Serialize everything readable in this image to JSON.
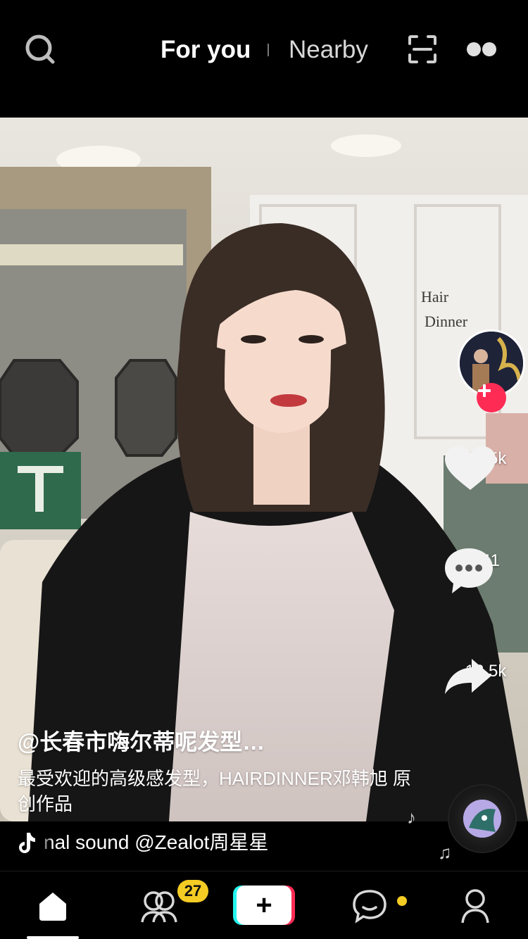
{
  "top_bar": {
    "tabs": [
      {
        "label": "For you",
        "active": true
      },
      {
        "label": "Nearby",
        "active": false
      }
    ],
    "left_icon": "search-icon",
    "right_icons": [
      "scan-icon",
      "live-dots-icon"
    ]
  },
  "video": {
    "scene_sign_line1": "Hair",
    "scene_sign_line2": "Dinner"
  },
  "right_rail": {
    "avatar_icon": "creator-avatar",
    "follow_icon": "plus-icon",
    "likes": "48.5k",
    "comments": "741",
    "shares": "12.5k"
  },
  "caption": {
    "username": "@长春市嗨尔蒂呢发型…",
    "description": "最受欢迎的高级感发型，HAIRDINNER邓韩旭 原创作品"
  },
  "music": {
    "note_icon": "tiktok-note-icon",
    "text": "nal sound     @Zealot周星星"
  },
  "bottom_nav": {
    "items": [
      "home-icon",
      "friends-icon",
      "create-icon",
      "inbox-icon",
      "profile-icon"
    ],
    "friends_badge": "27",
    "create_label": "+"
  },
  "colors": {
    "accent_red": "#fe2c55",
    "accent_cyan": "#25f4ee",
    "badge_yellow": "#f5cc24"
  }
}
